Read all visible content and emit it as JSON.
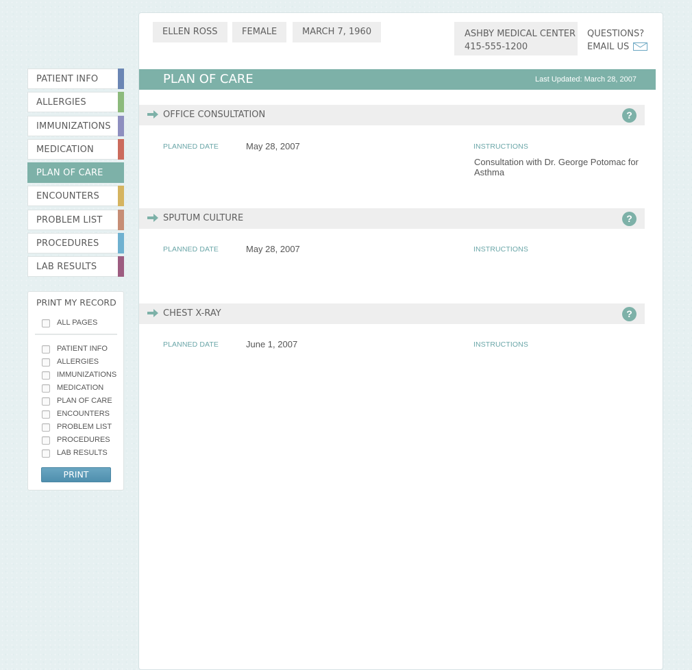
{
  "nav": {
    "items": [
      {
        "label": "PATIENT INFO",
        "color": "#6b86b4",
        "active": false
      },
      {
        "label": "ALLERGIES",
        "color": "#8cba7c",
        "active": false
      },
      {
        "label": "IMMUNIZATIONS",
        "color": "#8e8fbf",
        "active": false
      },
      {
        "label": "MEDICATION",
        "color": "#cb6b5d",
        "active": false
      },
      {
        "label": "PLAN OF CARE",
        "color": "#7db1a8",
        "active": true
      },
      {
        "label": "ENCOUNTERS",
        "color": "#d5b460",
        "active": false
      },
      {
        "label": "PROBLEM LIST",
        "color": "#c68e76",
        "active": false
      },
      {
        "label": "PROCEDURES",
        "color": "#6fb1d0",
        "active": false
      },
      {
        "label": "LAB RESULTS",
        "color": "#9c5c80",
        "active": false
      }
    ]
  },
  "print": {
    "title": "PRINT MY RECORD",
    "all_pages": "ALL PAGES",
    "options": [
      "PATIENT INFO",
      "ALLERGIES",
      "IMMUNIZATIONS",
      "MEDICATION",
      "PLAN OF CARE",
      "ENCOUNTERS",
      "PROBLEM LIST",
      "PROCEDURES",
      "LAB RESULTS"
    ],
    "button": "PRINT"
  },
  "header": {
    "name": "ELLEN ROSS",
    "gender": "FEMALE",
    "dob": "MARCH 7, 1960",
    "center_name": "ASHBY MEDICAL CENTER",
    "center_phone": "415-555-1200",
    "questions": "QUESTIONS?",
    "email": "EMAIL US"
  },
  "page": {
    "title": "PLAN OF CARE",
    "updated": "Last Updated: March 28, 2007"
  },
  "sections": [
    {
      "title": "OFFICE CONSULTATION",
      "planned_label": "PLANNED DATE",
      "planned_date": "May 28, 2007",
      "instructions_label": "INSTRUCTIONS",
      "instructions": "Consultation with Dr. George Potomac for Asthma"
    },
    {
      "title": "SPUTUM CULTURE",
      "planned_label": "PLANNED DATE",
      "planned_date": "May 28, 2007",
      "instructions_label": "INSTRUCTIONS",
      "instructions": ""
    },
    {
      "title": "CHEST X-RAY",
      "planned_label": "PLANNED DATE",
      "planned_date": "June 1, 2007",
      "instructions_label": "INSTRUCTIONS",
      "instructions": ""
    }
  ],
  "icons": {
    "section_arrow": "arrow-right-icon",
    "help": "help-icon",
    "mail": "mail-icon",
    "help_glyph": "?"
  },
  "colors": {
    "accent": "#7db1a8",
    "label": "#6aa6a8",
    "print_button": "#5a9ab8"
  }
}
